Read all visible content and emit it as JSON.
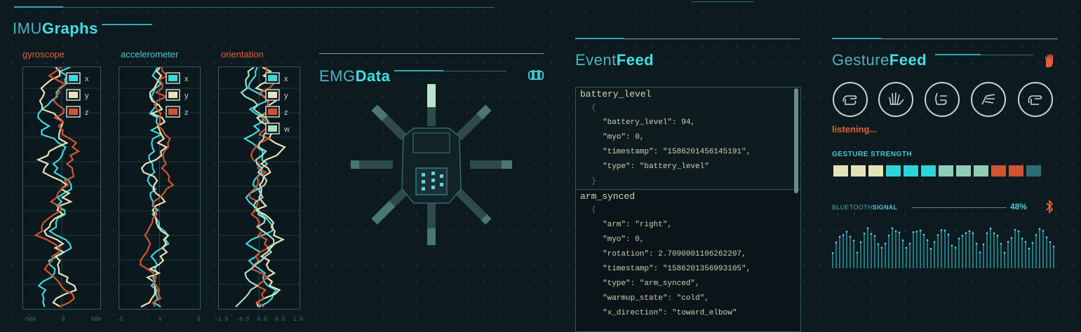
{
  "colors": {
    "x": "#3fd7dc",
    "y": "#e8e3b8",
    "z": "#cf5532",
    "w": "#a6dcc6",
    "accent": "#3fe0e8",
    "orange": "#e0613c"
  },
  "imu": {
    "title_a": "IMU",
    "title_b": "Graphs",
    "graphs": [
      {
        "label": "gyroscope",
        "legend": [
          "x",
          "y",
          "z"
        ],
        "ticks": [
          "-500",
          "0",
          "500"
        ]
      },
      {
        "label": "accelerometer",
        "legend": [
          "x",
          "y",
          "z"
        ],
        "ticks": [
          "-5",
          "0",
          "5"
        ]
      },
      {
        "label": "orientation",
        "legend": [
          "x",
          "y",
          "z",
          "w"
        ],
        "ticks": [
          "-1.0",
          "-0.5",
          "0.0",
          "0.5",
          "1.0"
        ]
      }
    ]
  },
  "emg": {
    "title_a": "EMG",
    "title_b": "Data",
    "icon": "armband-icon"
  },
  "events": {
    "title_a": "Event",
    "title_b": "Feed",
    "items": [
      {
        "name": "battery_level",
        "open": "{",
        "close": "}",
        "lines": [
          "\"battery_level\": 94,",
          "\"myo\": 0,",
          "\"timestamp\": \"1586201456145191\",",
          "\"type\": \"battery_level\""
        ]
      },
      {
        "name": "arm_synced",
        "open": "{",
        "lines": [
          "\"arm\": \"right\",",
          "\"myo\": 0,",
          "\"rotation\": 2.7090001106262207,",
          "\"timestamp\": \"1586201356993105\",",
          "\"type\": \"arm_synced\",",
          "\"warmup_state\": \"cold\",",
          "\"x_direction\": \"toward_elbow\""
        ]
      }
    ]
  },
  "gestures": {
    "title_a": "Gesture",
    "title_b": "Feed",
    "icon": "hand-icon",
    "status": "listening...",
    "strength_label": "GESTURE STRENGTH",
    "strength_colors": [
      "#e6e2b8",
      "#e6e2b8",
      "#e6e2b8",
      "#2fd4d8",
      "#2fd4d8",
      "#2fd4d8",
      "#8fcdb6",
      "#8fcdb6",
      "#8fcdb6",
      "#cf5532",
      "#cf5532",
      "#2d6d78"
    ],
    "items": [
      "fist-gesture-icon",
      "fingers-spread-gesture-icon",
      "wave-in-gesture-icon",
      "wave-out-gesture-icon",
      "double-tap-gesture-icon"
    ]
  },
  "bluetooth": {
    "label_a": "BLUETOOTH",
    "label_b": "SIGNAL",
    "value": "48%",
    "icon": "bluetooth-icon"
  }
}
